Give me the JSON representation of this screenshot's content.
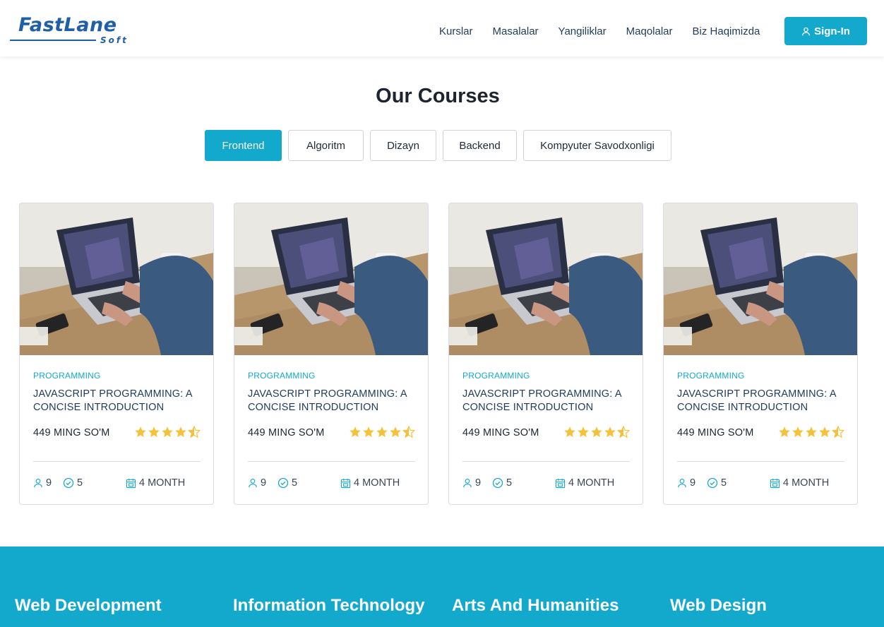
{
  "brand": {
    "name": "FastLane",
    "sub": "Soft",
    "color": "#1e5fa8"
  },
  "nav": {
    "items": [
      "Kurslar",
      "Masalalar",
      "Yangiliklar",
      "Maqolalar",
      "Biz Haqimizda"
    ],
    "signin_label": "Sign-In"
  },
  "colors": {
    "accent": "#13a9cd",
    "star": "#f5c13b"
  },
  "courses": {
    "title": "Our Courses",
    "tabs": [
      {
        "label": "Frontend",
        "active": true
      },
      {
        "label": "Algoritm",
        "active": false
      },
      {
        "label": "Dizayn",
        "active": false
      },
      {
        "label": "Backend",
        "active": false
      },
      {
        "label": "Kompyuter Savodxonligi",
        "active": false
      }
    ],
    "cards": [
      {
        "category": "PROGRAMMING",
        "title": "JAVASCRIPT PROGRAMMING: A CONCISE INTRODUCTION",
        "price": "449 MING SO'M",
        "rating": 4.5,
        "students": "9",
        "lessons": "5",
        "duration": "4 MONTH"
      },
      {
        "category": "PROGRAMMING",
        "title": "JAVASCRIPT PROGRAMMING: A CONCISE INTRODUCTION",
        "price": "449 MING SO'M",
        "rating": 4.5,
        "students": "9",
        "lessons": "5",
        "duration": "4 MONTH"
      },
      {
        "category": "PROGRAMMING",
        "title": "JAVASCRIPT PROGRAMMING: A CONCISE INTRODUCTION",
        "price": "449 MING SO'M",
        "rating": 4.5,
        "students": "9",
        "lessons": "5",
        "duration": "4 MONTH"
      },
      {
        "category": "PROGRAMMING",
        "title": "JAVASCRIPT PROGRAMMING: A CONCISE INTRODUCTION",
        "price": "449 MING SO'M",
        "rating": 4.5,
        "students": "9",
        "lessons": "5",
        "duration": "4 MONTH"
      }
    ]
  },
  "categories": [
    "Web Development",
    "Information Technology",
    "Arts And Humanities",
    "Web Design"
  ]
}
